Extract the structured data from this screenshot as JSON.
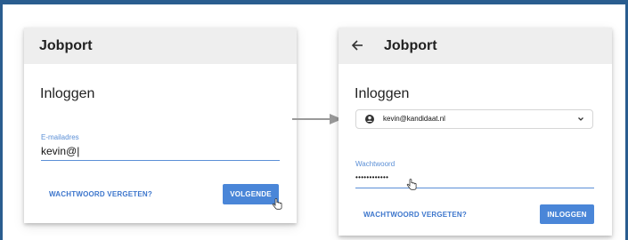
{
  "left_card": {
    "app_title": "Jobport",
    "heading": "Inloggen",
    "email_label": "E-mailadres",
    "email_value": "kevin@|",
    "forgot_label": "WACHTWOORD VERGETEN?",
    "next_label": "VOLGENDE"
  },
  "right_card": {
    "app_title": "Jobport",
    "heading": "Inloggen",
    "account_email": "kevin@kandidaat.nl",
    "password_label": "Wachtwoord",
    "password_value": "••••••••••••",
    "forgot_label": "WACHTWOORD VERGETEN?",
    "login_label": "INLOGGEN"
  },
  "colors": {
    "outer_background": "#2a5d8f",
    "accent": "#4a86d8",
    "link": "#3d76cc",
    "appbar": "#eeeeee"
  },
  "icons": [
    "back-arrow-icon",
    "account-circle-icon",
    "chevron-down-icon",
    "pointer-cursor-icon",
    "flow-arrow-icon"
  ]
}
